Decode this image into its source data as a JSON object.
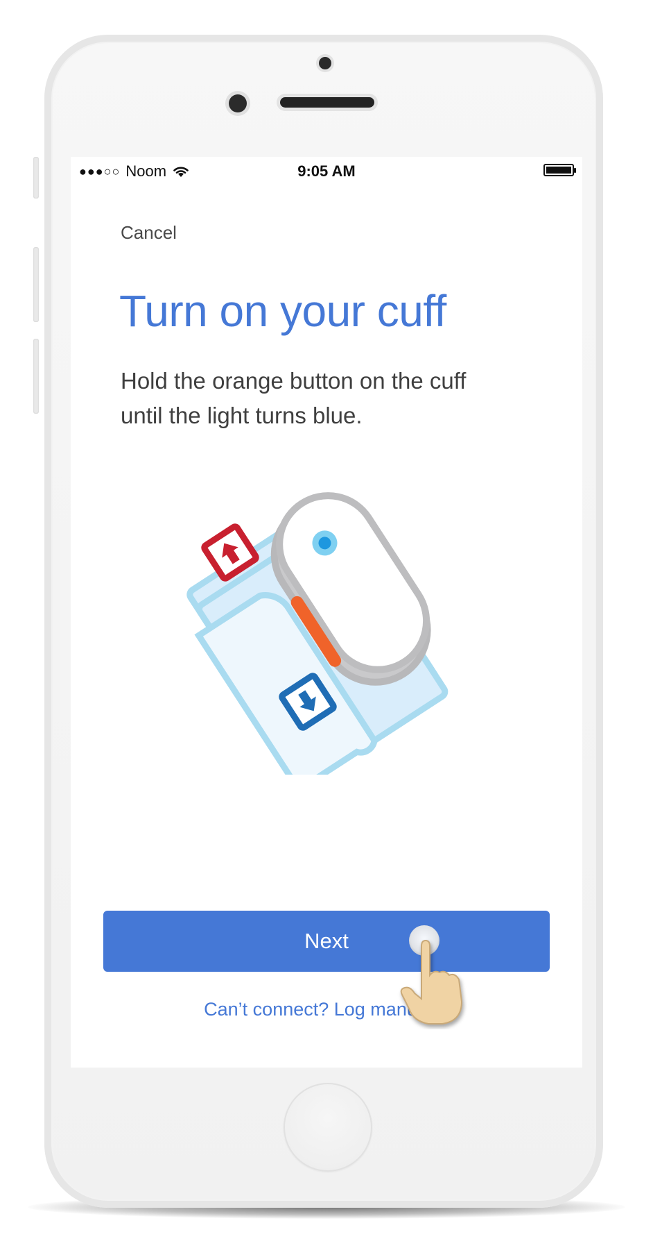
{
  "status_bar": {
    "signal": "●●●○○",
    "carrier": "Noom",
    "time": "9:05 AM"
  },
  "header": {
    "cancel_label": "Cancel"
  },
  "main": {
    "title": "Turn on your cuff",
    "instructions": "Hold the orange button on the cuff until the light turns blue."
  },
  "actions": {
    "next_label": "Next",
    "manual_link": "Can’t connect? Log manually."
  },
  "icons": [
    "wifi-icon",
    "battery-icon",
    "cuff-illustration",
    "tap-hand-icon"
  ],
  "colors": {
    "accent": "#4578d6",
    "cuff_light_blue": "#d9edfb",
    "cuff_border": "#a9dbf0",
    "orange_button": "#f0632a",
    "up_arrow_red": "#c8202f",
    "down_arrow_blue": "#1f6db5"
  }
}
